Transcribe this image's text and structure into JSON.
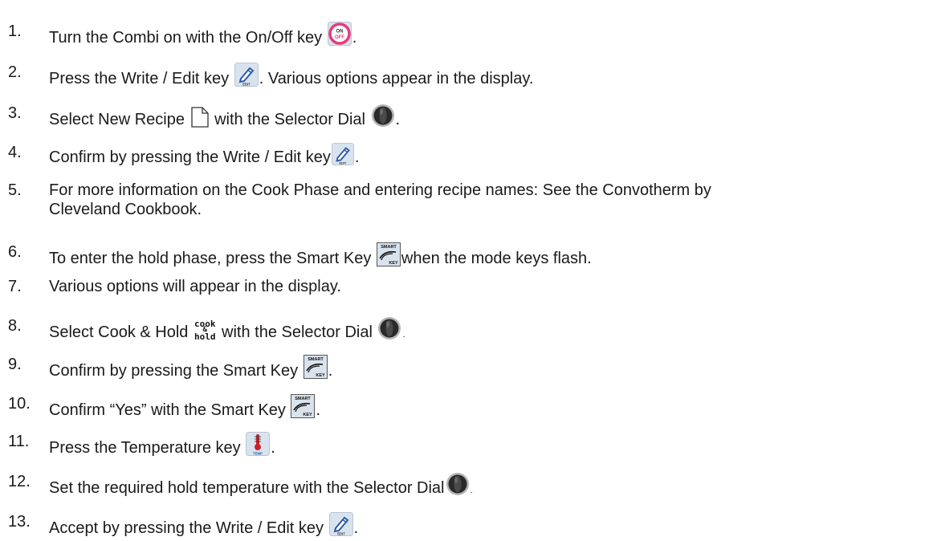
{
  "steps": [
    {
      "num": "1.",
      "before": "Turn the Combi on with the On/Off key",
      "after": ".",
      "icon": "on-off-key-icon",
      "icon_text": [
        "ON",
        "OFF"
      ]
    },
    {
      "num": "2.",
      "before": "Press the Write / Edit key",
      "after": ". Various options appear in the display.",
      "icon": "write-edit-key-icon",
      "icon_text": [
        "EDIT"
      ]
    },
    {
      "num": "3.",
      "before": "Select New Recipe",
      "middle": "with the Selector Dial",
      "after": ".",
      "icon": "new-recipe-icon",
      "icon2": "selector-dial-icon"
    },
    {
      "num": "4.",
      "before": "Confirm by pressing the Write / Edit key",
      "after": ".",
      "icon": "write-edit-key-icon",
      "icon_text": [
        "EDIT"
      ]
    },
    {
      "num": "5.",
      "line1": "For more information on the Cook Phase and entering recipe names: See the Convotherm by",
      "line2": "Cleveland Cookbook."
    },
    {
      "num": "6.",
      "before": "To enter the hold phase, press the Smart Key",
      "after": "when the mode keys flash.",
      "icon": "smart-key-icon",
      "icon_text": [
        "SMART",
        "KEY"
      ]
    },
    {
      "num": "7.",
      "text": "Various options will appear in the display."
    },
    {
      "num": "8.",
      "before": "Select Cook & Hold",
      "cook_hold": [
        "cook",
        "&",
        "hold"
      ],
      "middle": "with the Selector Dial",
      "after": ".",
      "icon": "selector-dial-icon"
    },
    {
      "num": "9.",
      "before": "Confirm by pressing the Smart Key",
      "after": ".",
      "icon": "smart-key-icon",
      "icon_text": [
        "SMART",
        "KEY"
      ]
    },
    {
      "num": "10.",
      "before": "Confirm “Yes” with the Smart Key",
      "after": ".",
      "icon": "smart-key-icon",
      "icon_text": [
        "SMART",
        "KEY"
      ]
    },
    {
      "num": "11.",
      "before": "Press the Temperature key",
      "after": ".",
      "icon": "temperature-key-icon",
      "icon_text": [
        "TEMP"
      ]
    },
    {
      "num": "12.",
      "before": "Set the required hold temperature with the Selector Dial",
      "after": ".",
      "icon": "selector-dial-icon"
    },
    {
      "num": "13.",
      "before": "Accept by pressing the Write / Edit key",
      "after": ".",
      "icon": "write-edit-key-icon",
      "icon_text": [
        "EDIT"
      ]
    }
  ],
  "colors": {
    "text": "#1a1a1a",
    "on_off_ring": "#e83a7c",
    "key_background": "#d9e3ee",
    "pencil_blue": "#2d5aa8",
    "thermometer_red": "#d0202a",
    "dial_dark": "#2a2a2a"
  }
}
